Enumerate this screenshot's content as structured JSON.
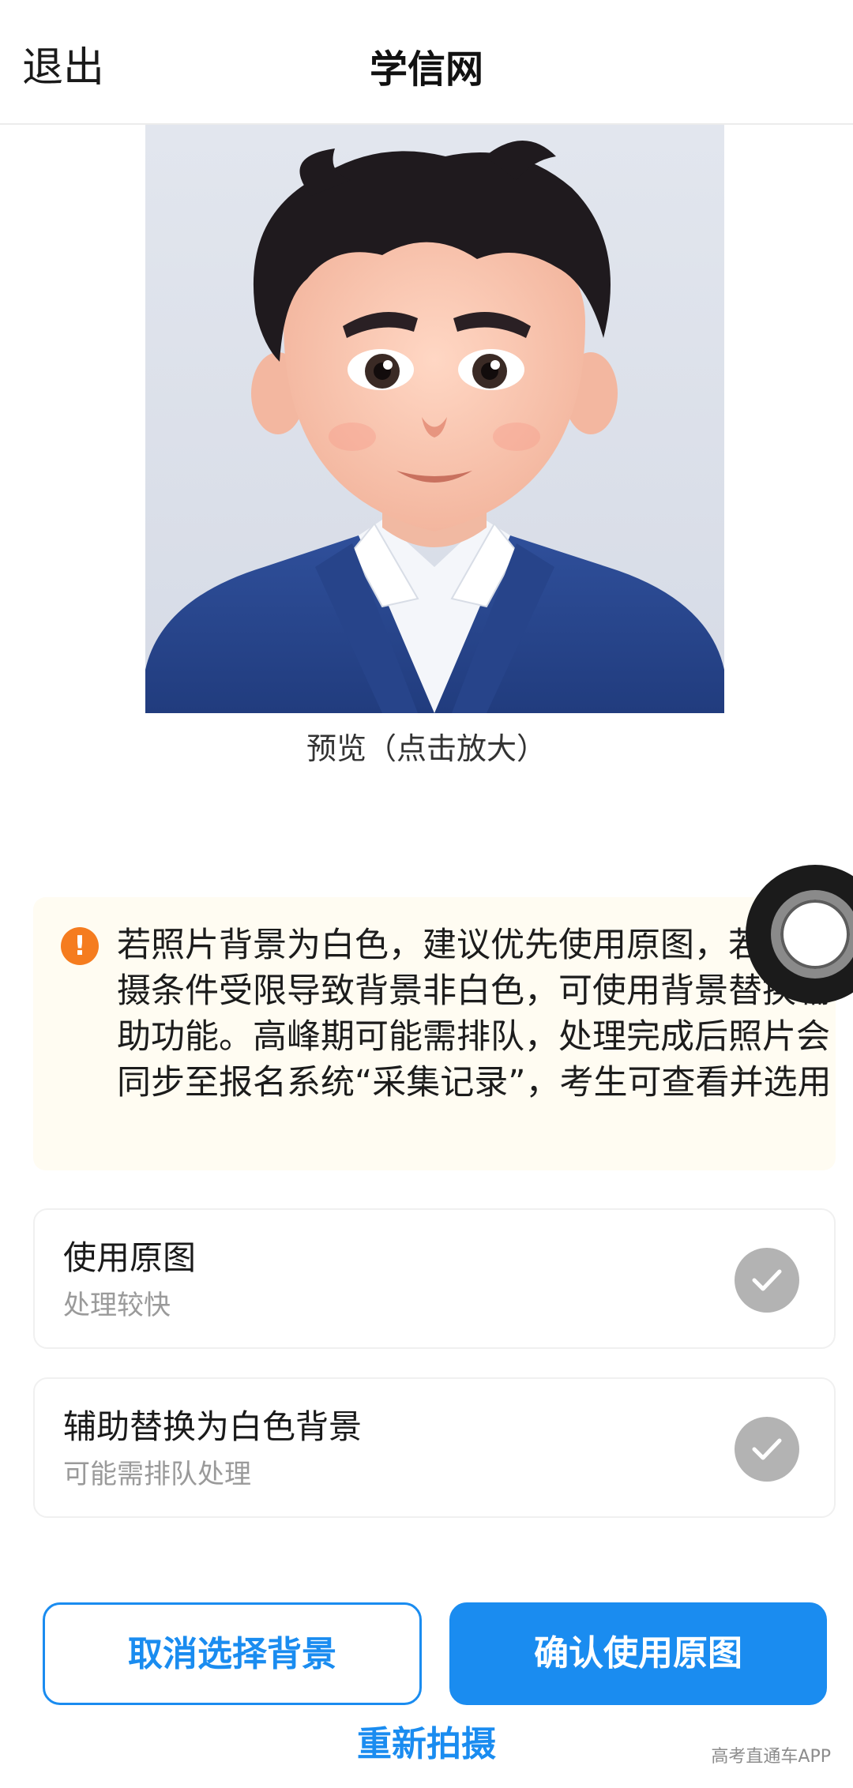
{
  "header": {
    "exit_label": "退出",
    "title": "学信网"
  },
  "photo": {
    "caption": "预览（点击放大）"
  },
  "notice": {
    "icon": "exclamation-icon",
    "accent_color": "#f57c1f",
    "text": "若照片背景为白色，建议优先使用原图，若因拍摄条件受限导致背景非白色，可使用背景替换辅助功能。高峰期可能需排队，处理完成后照片会同步至报名系统“采集记录”，考生可查看并选用"
  },
  "options": [
    {
      "title": "使用原图",
      "subtitle": "处理较快",
      "icon": "check-icon"
    },
    {
      "title": "辅助替换为白色背景",
      "subtitle": "可能需排队处理",
      "icon": "check-icon"
    }
  ],
  "buttons": {
    "cancel_label": "取消选择背景",
    "confirm_label": "确认使用原图",
    "retake_label": "重新拍摄",
    "accent_color": "#1a8cf0"
  },
  "watermark": "高考直通车APP"
}
